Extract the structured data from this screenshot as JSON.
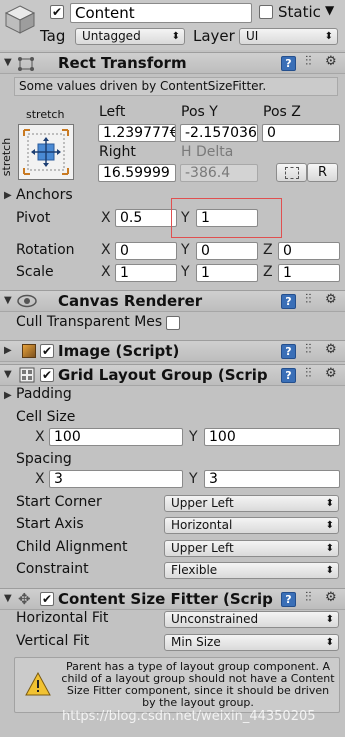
{
  "gameobject": {
    "active": true,
    "name": "Content",
    "static_label": "Static",
    "static_checked": false,
    "tag_label": "Tag",
    "tag_value": "Untagged",
    "layer_label": "Layer",
    "layer_value": "UI"
  },
  "rect_transform": {
    "title": "Rect Transform",
    "info": "Some values driven by ContentSizeFitter.",
    "anchor_top": "stretch",
    "anchor_side": "stretch",
    "col1_label": "Left",
    "col2_label": "Pos Y",
    "col3_label": "Pos Z",
    "left": "1.239777€",
    "pos_y": "-2.157036",
    "pos_z": "0",
    "col4_label": "Right",
    "col5_label": "H Delta",
    "right": "16.59999",
    "h_delta": "-386.4",
    "r_button": "R",
    "anchors_label": "Anchors",
    "pivot_label": "Pivot",
    "pivot_x_label": "X",
    "pivot_x": "0.5",
    "pivot_y_label": "Y",
    "pivot_y": "1",
    "rotation_label": "Rotation",
    "rot_x_label": "X",
    "rot_x": "0",
    "rot_y_label": "Y",
    "rot_y": "0",
    "rot_z_label": "Z",
    "rot_z": "0",
    "scale_label": "Scale",
    "scale_x_label": "X",
    "scale_x": "1",
    "scale_y_label": "Y",
    "scale_y": "1",
    "scale_z_label": "Z",
    "scale_z": "1"
  },
  "canvas_renderer": {
    "title": "Canvas Renderer",
    "cull_label": "Cull Transparent Mes",
    "cull_checked": false
  },
  "image_script": {
    "title": "Image (Script)",
    "enabled": true
  },
  "grid_layout": {
    "title": "Grid Layout Group (Scrip",
    "enabled": true,
    "padding_label": "Padding",
    "cell_size_label": "Cell Size",
    "cell_x_label": "X",
    "cell_x": "100",
    "cell_y_label": "Y",
    "cell_y": "100",
    "spacing_label": "Spacing",
    "spacing_x_label": "X",
    "spacing_x": "3",
    "spacing_y_label": "Y",
    "spacing_y": "3",
    "start_corner_label": "Start Corner",
    "start_corner": "Upper Left",
    "start_axis_label": "Start Axis",
    "start_axis": "Horizontal",
    "child_alignment_label": "Child Alignment",
    "child_alignment": "Upper Left",
    "constraint_label": "Constraint",
    "constraint": "Flexible"
  },
  "content_size_fitter": {
    "title": "Content Size Fitter (Scrip",
    "enabled": true,
    "horizontal_fit_label": "Horizontal Fit",
    "horizontal_fit": "Unconstrained",
    "vertical_fit_label": "Vertical Fit",
    "vertical_fit": "Min Size",
    "warning": "Parent has a type of layout group component. A child of a layout group should not have a Content Size Fitter component, since it should be driven by the layout group."
  },
  "watermark": "https://blog.csdn.net/weixin_44350205",
  "colors": {
    "panel_bg": "#c2c2c2",
    "header_bg": "#c4c4c4",
    "highlight_box": "#e05050",
    "help_icon": "#3a6fb7"
  }
}
